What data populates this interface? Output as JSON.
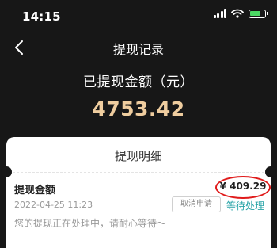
{
  "status_bar": {
    "time": "14:15",
    "icons": [
      "signal-icon",
      "wifi-icon",
      "battery-charging-icon"
    ]
  },
  "nav": {
    "back_icon": "chevron-left-icon",
    "title": "提现记录"
  },
  "summary": {
    "label": "已提现金额（元）",
    "amount": "4753.42",
    "amount_color": "#efcd9f"
  },
  "detail_card": {
    "title": "提现明细",
    "records": [
      {
        "title": "提现金额",
        "amount": "¥ 409.29",
        "date": "2022-04-25 11:23",
        "cancel_label": "取消申请",
        "status": "等待处理",
        "status_color": "#26a3a6",
        "note": "您的提现正在处理中，请耐心等待～"
      }
    ]
  },
  "colors": {
    "background": "#171717",
    "card": "#ffffff",
    "highlight_circle": "#e01b1b"
  }
}
